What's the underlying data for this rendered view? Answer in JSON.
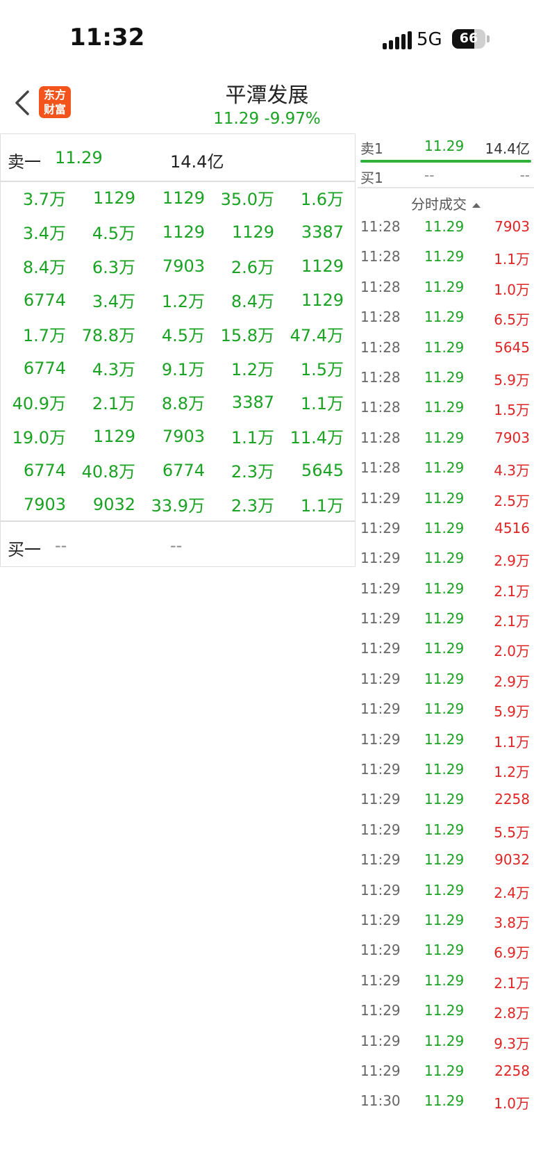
{
  "status_bar": {
    "time": "11:32",
    "network": "5G",
    "battery": "66",
    "battery_level": 0.66
  },
  "header": {
    "logo_line1": "东方",
    "logo_line2": "财富",
    "title": "平潭发展",
    "price_change": "11.29  -9.97%"
  },
  "order_book": {
    "ask_label": "卖一",
    "ask_price": "11.29",
    "ask_volume": "14.4亿",
    "grid": [
      [
        "3.7万",
        "1129",
        "1129",
        "35.0万",
        "1.6万"
      ],
      [
        "3.4万",
        "4.5万",
        "1129",
        "1129",
        "3387"
      ],
      [
        "8.4万",
        "6.3万",
        "7903",
        "2.6万",
        "1129"
      ],
      [
        "6774",
        "3.4万",
        "1.2万",
        "8.4万",
        "1129"
      ],
      [
        "1.7万",
        "78.8万",
        "4.5万",
        "15.8万",
        "47.4万"
      ],
      [
        "6774",
        "4.3万",
        "9.1万",
        "1.2万",
        "1.5万"
      ],
      [
        "40.9万",
        "2.1万",
        "8.8万",
        "3387",
        "1.1万"
      ],
      [
        "19.0万",
        "1129",
        "7903",
        "1.1万",
        "11.4万"
      ],
      [
        "6774",
        "40.8万",
        "6774",
        "2.3万",
        "5645"
      ],
      [
        "7903",
        "9032",
        "33.9万",
        "2.3万",
        "1.1万"
      ]
    ],
    "bid_label": "买一",
    "bid_price": "--",
    "bid_volume": "--"
  },
  "side_panel": {
    "sell1": {
      "label": "卖1",
      "price": "11.29",
      "volume": "14.4亿"
    },
    "buy1": {
      "label": "买1",
      "price": "--",
      "volume": "--"
    },
    "ticks_header": "分时成交",
    "ticks": [
      [
        "11:28",
        "11.29",
        "7903"
      ],
      [
        "11:28",
        "11.29",
        "1.1万"
      ],
      [
        "11:28",
        "11.29",
        "1.0万"
      ],
      [
        "11:28",
        "11.29",
        "6.5万"
      ],
      [
        "11:28",
        "11.29",
        "5645"
      ],
      [
        "11:28",
        "11.29",
        "5.9万"
      ],
      [
        "11:28",
        "11.29",
        "1.5万"
      ],
      [
        "11:28",
        "11.29",
        "7903"
      ],
      [
        "11:28",
        "11.29",
        "4.3万"
      ],
      [
        "11:29",
        "11.29",
        "2.5万"
      ],
      [
        "11:29",
        "11.29",
        "4516"
      ],
      [
        "11:29",
        "11.29",
        "2.9万"
      ],
      [
        "11:29",
        "11.29",
        "2.1万"
      ],
      [
        "11:29",
        "11.29",
        "2.1万"
      ],
      [
        "11:29",
        "11.29",
        "2.0万"
      ],
      [
        "11:29",
        "11.29",
        "2.9万"
      ],
      [
        "11:29",
        "11.29",
        "5.9万"
      ],
      [
        "11:29",
        "11.29",
        "1.1万"
      ],
      [
        "11:29",
        "11.29",
        "1.2万"
      ],
      [
        "11:29",
        "11.29",
        "2258"
      ],
      [
        "11:29",
        "11.29",
        "5.5万"
      ],
      [
        "11:29",
        "11.29",
        "9032"
      ],
      [
        "11:29",
        "11.29",
        "2.4万"
      ],
      [
        "11:29",
        "11.29",
        "3.8万"
      ],
      [
        "11:29",
        "11.29",
        "6.9万"
      ],
      [
        "11:29",
        "11.29",
        "2.1万"
      ],
      [
        "11:29",
        "11.29",
        "2.8万"
      ],
      [
        "11:29",
        "11.29",
        "9.3万"
      ],
      [
        "11:29",
        "11.29",
        "2258"
      ],
      [
        "11:30",
        "11.29",
        "1.0万"
      ]
    ]
  }
}
